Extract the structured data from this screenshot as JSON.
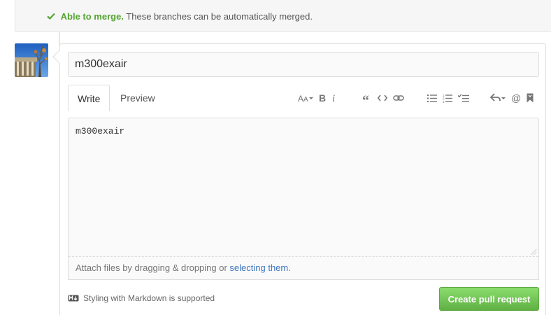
{
  "merge": {
    "check_icon": "check-icon",
    "status": "Able to merge.",
    "message": "These branches can be automatically merged."
  },
  "comment_form": {
    "title_value": "m300exair",
    "tabs": [
      {
        "label": "Write",
        "active": true
      },
      {
        "label": "Preview",
        "active": false
      }
    ],
    "toolbar_icons": [
      "text-size-icon",
      "bold-icon",
      "italic-icon",
      "quote-icon",
      "code-icon",
      "link-icon",
      "unordered-list-icon",
      "ordered-list-icon",
      "task-list-icon",
      "reply-icon",
      "mention-icon",
      "bookmark-icon"
    ],
    "body_value": "m300exair",
    "attach_text": "Attach files by dragging & dropping or ",
    "attach_link": "selecting them",
    "attach_suffix": ".",
    "markdown_note": "Styling with Markdown is supported",
    "submit_label": "Create pull request"
  },
  "colors": {
    "success_green": "#55a532",
    "link_blue": "#4078c0",
    "button_green": "#60b044"
  }
}
